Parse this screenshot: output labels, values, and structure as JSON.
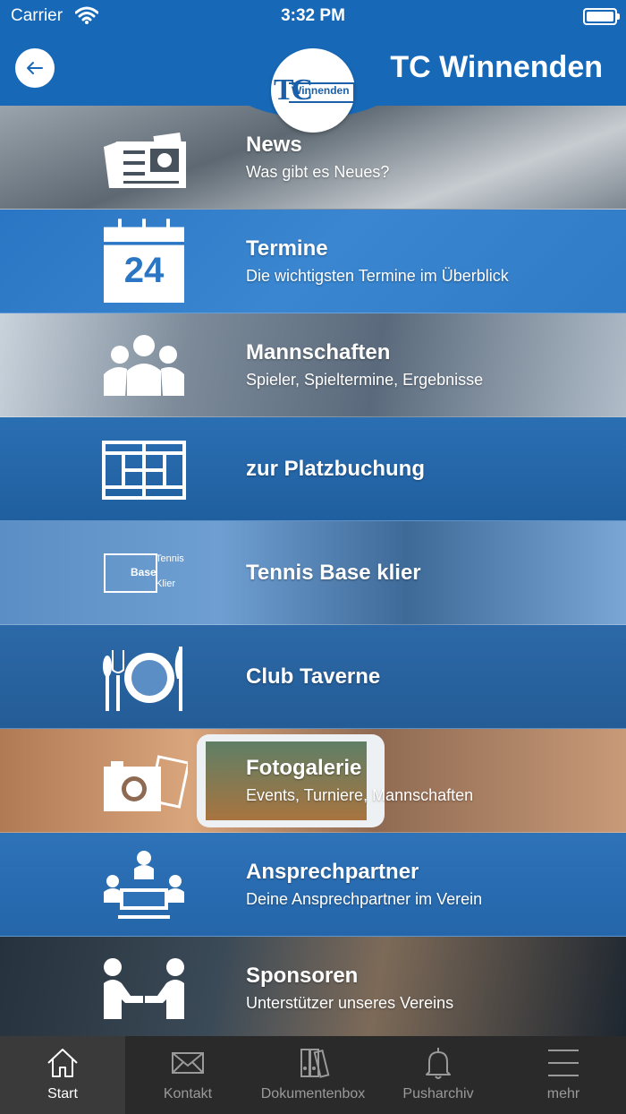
{
  "status_bar": {
    "carrier": "Carrier",
    "time": "3:32 PM"
  },
  "header": {
    "title": "TC Winnenden",
    "logo_initials": "TC",
    "logo_text": "Winnenden"
  },
  "menu": [
    {
      "title": "News",
      "subtitle": "Was gibt es Neues?",
      "icon": "newspaper-icon"
    },
    {
      "title": "Termine",
      "subtitle": "Die wichtigsten Termine im Überblick",
      "icon": "calendar-icon",
      "calendar_day": "24"
    },
    {
      "title": "Mannschaften",
      "subtitle": "Spieler, Spieltermine, Ergebnisse",
      "icon": "team-icon"
    },
    {
      "title": "zur Platzbuchung",
      "subtitle": "",
      "icon": "court-icon"
    },
    {
      "title": "Tennis Base klier",
      "subtitle": "",
      "icon": "tennis-base-logo",
      "logo_words": [
        "Tennis",
        "Base",
        "Klier"
      ]
    },
    {
      "title": "Club Taverne",
      "subtitle": "",
      "icon": "restaurant-icon"
    },
    {
      "title": "Fotogalerie",
      "subtitle": "Events, Turniere, Mannschaften",
      "icon": "camera-icon"
    },
    {
      "title": "Ansprechpartner",
      "subtitle": "Deine Ansprechpartner im Verein",
      "icon": "contact-persons-icon"
    },
    {
      "title": "Sponsoren",
      "subtitle": "Unterstützer unseres Vereins",
      "icon": "handshake-icon"
    }
  ],
  "tabs": [
    {
      "label": "Start",
      "icon": "home-icon",
      "active": true
    },
    {
      "label": "Kontakt",
      "icon": "mail-icon",
      "active": false
    },
    {
      "label": "Dokumentenbox",
      "icon": "binders-icon",
      "active": false
    },
    {
      "label": "Pusharchiv",
      "icon": "bell-icon",
      "active": false
    },
    {
      "label": "mehr",
      "icon": "menu-icon",
      "active": false
    }
  ],
  "colors": {
    "brand_blue": "#1769b8",
    "tabbar": "#2a2a2a"
  }
}
